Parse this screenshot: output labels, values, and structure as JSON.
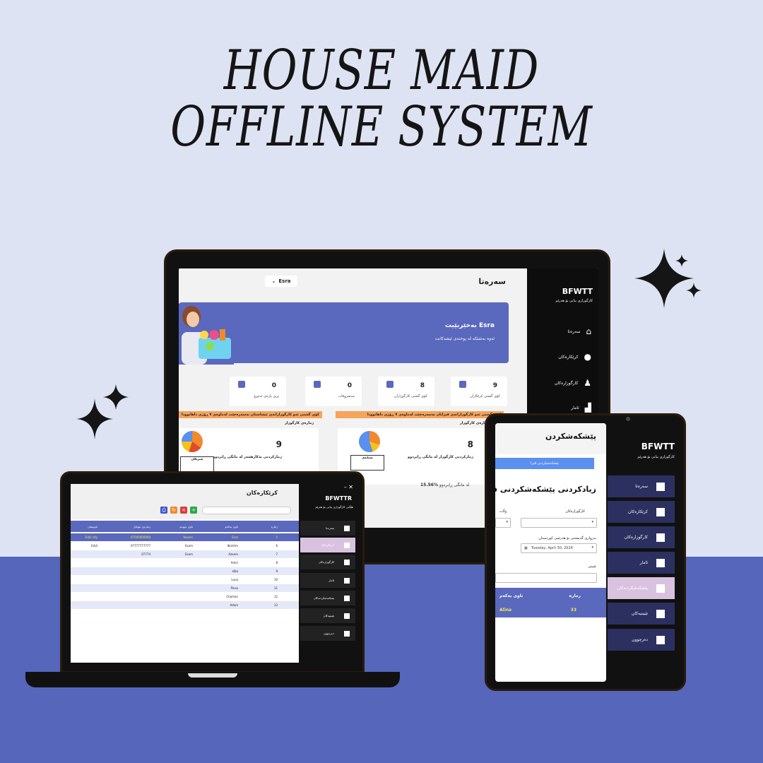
{
  "headline": {
    "line1": "HOUSE MAID",
    "line2": "OFFLINE SYSTEM"
  },
  "colors": {
    "accent": "#5a68bd",
    "orange": "#f5a45c",
    "sidebar": "#0d0d0d",
    "active_nav": "#d9c2e0",
    "highlight": "#f4e94c"
  },
  "monitor": {
    "page_title": "سەرەتا",
    "user_selector": "Esra",
    "banner_title": "بەخێربێیت Esra",
    "banner_subtitle": "ئەوە بەشێکە لە پوختەی ئیشەکانت",
    "stats": [
      {
        "value": "9",
        "label": "کۆی گشتی کرێکاران"
      },
      {
        "value": "8",
        "label": "کۆی گشتی کارگوزاران"
      },
      {
        "value": "0",
        "label": "مەصروفات"
      },
      {
        "value": "0",
        "label": "بڕی پارەی ئەمڕۆ"
      }
    ],
    "alert_left": "کۆی گشتی ئەو کارگوزارانەی ئیشاسیان بەسەرەچێت لەماوەی ٧ ڕۆژی داهاتوودا",
    "alert_right": "کۆی گشتی ئەو کارگوزارانەی ڤیزایان بەسەرەچێت لەماوەی ٧ ڕۆژی داهاتوودا",
    "sub_left": "ژمارەی کارگوزار",
    "sub_right": "ژمارەی کارگوزار",
    "card_left": {
      "value": "8",
      "label": "ژمارکردنی کارگوزار لە مانگی ڕابردوو",
      "pie_title": "ئەمانەی"
    },
    "card_right": {
      "value": "9",
      "label": "ژمارکردنی بەکارهێنەر لە مانگی ڕابردوو",
      "pie_title": "ئەتریکان"
    },
    "percent": "15.56",
    "percent_label": "لە مانگی ڕابردوو",
    "brand": "BFWTT",
    "brand_sub": "کارگوزاری بیانی بۆ هەرێم",
    "nav": [
      "سەرەتا",
      "کرێکارەکان",
      "کارگوزارەکان",
      "ئامار"
    ]
  },
  "laptop": {
    "page_title": "کرێکارەکان",
    "brand": "BFWTTR",
    "brand_sub": "هێڵانی کارگوزاری بیانی بۆ هەرێم",
    "columns": [
      "ژمارە",
      "ناوی یەکەم",
      "ناوی دووەم",
      "ژمارەی مۆبایل",
      "ناونیشان"
    ],
    "rows": [
      {
        "id": "5",
        "first": "Esra",
        "second": "Yaseen",
        "phone": "07500000000",
        "address": "Erbil city"
      },
      {
        "id": "6",
        "first": "Ibrahim",
        "second": "Esam",
        "phone": "07777777777",
        "address": "Erbil"
      },
      {
        "id": "7",
        "first": "Azeem",
        "second": "Esam",
        "phone": "07774",
        "address": ""
      },
      {
        "id": "8",
        "first": "Amin",
        "second": "",
        "phone": "",
        "address": ""
      },
      {
        "id": "9",
        "first": "alba",
        "second": "",
        "phone": "",
        "address": ""
      },
      {
        "id": "10",
        "first": "Luna",
        "second": "",
        "phone": "",
        "address": ""
      },
      {
        "id": "11",
        "first": "Pinsa",
        "second": "",
        "phone": "",
        "address": ""
      },
      {
        "id": "12",
        "first": "Chaman",
        "second": "",
        "phone": "",
        "address": ""
      },
      {
        "id": "13",
        "first": "Adam",
        "second": "",
        "phone": "",
        "address": ""
      }
    ],
    "nav": [
      "سەرەتا",
      "کرێکارەکان",
      "کارگوزارەکان",
      "ئامار",
      "پشکنەشکردنەکان",
      "تێبینیەکان",
      "دەرچوون"
    ]
  },
  "tablet": {
    "page_title": "پێشکەشکردن",
    "add_button": "پێشکەشکردنی ڤیزا",
    "form_title": "زیادکردنی پێشکەشکردنی ڤیزا",
    "labels": {
      "worker": "کارگوزارەکان",
      "date": "بەرواری گەیشتنی بۆ هەرێمی کوردستان",
      "note": "تێبینی",
      "time": "وڵات"
    },
    "date_value": "Tuesday, April 30, 2024",
    "columns": [
      "زمارە",
      "ناوی یەکەم"
    ],
    "row": {
      "id": "33",
      "name": "Alina"
    },
    "brand": "BFWTT",
    "brand_sub": "کارگوزاری بیانی بۆ هەرێم",
    "nav": [
      "سەرەتا",
      "کرێکارەکان",
      "کارگوزارەکان",
      "ئامار",
      "پێشکەشکردنەکان",
      "تێبینیەکان",
      "دەرچوون"
    ]
  }
}
